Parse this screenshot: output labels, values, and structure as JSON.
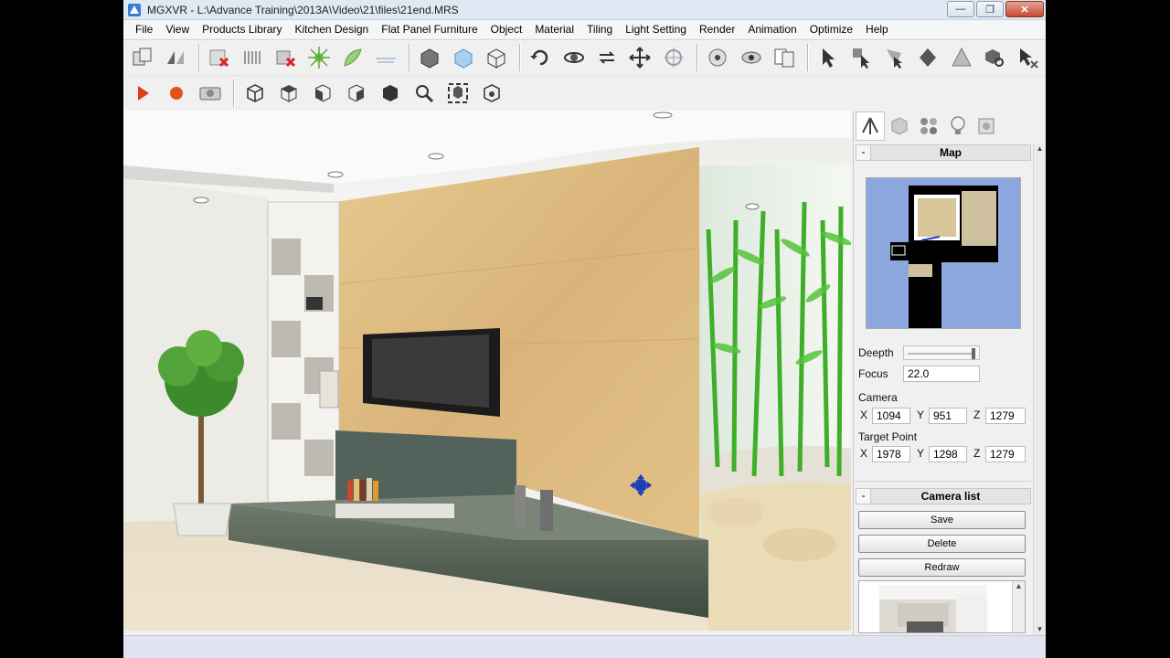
{
  "window": {
    "title": "MGXVR - L:\\Advance Training\\2013A\\Video\\21\\files\\21end.MRS",
    "minimize": "—",
    "maximize": "❐",
    "close": "✕"
  },
  "menu": [
    "File",
    "View",
    "Products Library",
    "Kitchen Design",
    "Flat Panel Furniture",
    "Object",
    "Material",
    "Tiling",
    "Light Setting",
    "Render",
    "Animation",
    "Optimize",
    "Help"
  ],
  "right_panel": {
    "map_section": {
      "toggle": "-",
      "title": "Map"
    },
    "depth_label": "Deepth",
    "depth_value": 0.95,
    "focus_label": "Focus",
    "focus_value": "22.0",
    "camera": {
      "label": "Camera",
      "x_label": "X",
      "x": "1094",
      "y_label": "Y",
      "y": "951",
      "z_label": "Z",
      "z": "1279"
    },
    "target": {
      "label": "Target Point",
      "x_label": "X",
      "x": "1978",
      "y_label": "Y",
      "y": "1298",
      "z_label": "Z",
      "z": "1279"
    },
    "camera_list": {
      "toggle": "-",
      "title": "Camera list"
    },
    "save_label": "Save",
    "delete_label": "Delete",
    "redraw_label": "Redraw"
  },
  "colors": {
    "accent_blue": "#4472c4",
    "map_bg": "#8ba7de",
    "title_bg": "#dfe8f3"
  }
}
